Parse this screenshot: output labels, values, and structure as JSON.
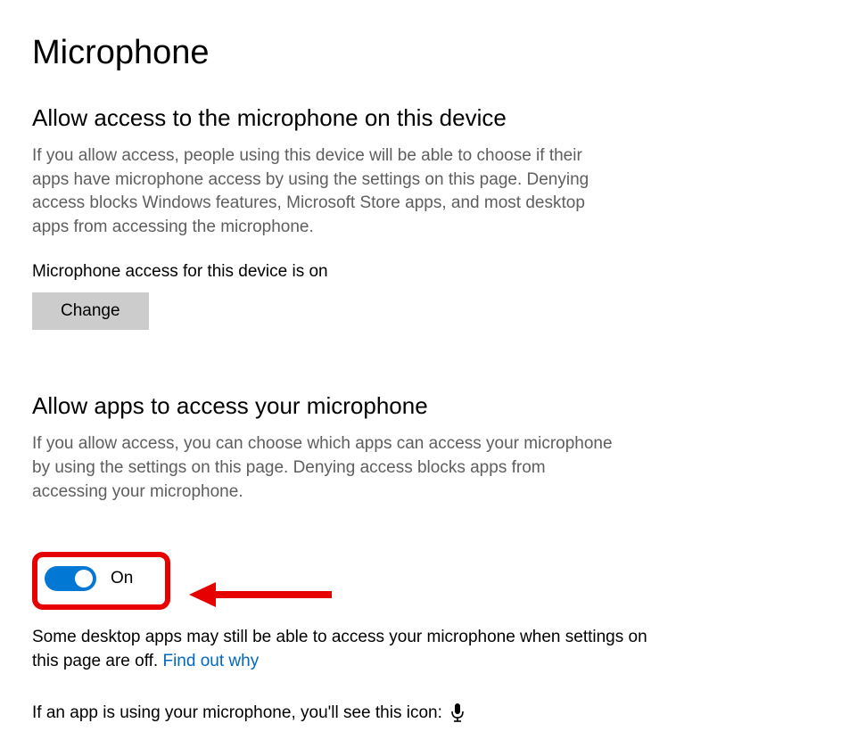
{
  "page_title": "Microphone",
  "section1": {
    "heading": "Allow access to the microphone on this device",
    "description": "If you allow access, people using this device will be able to choose if their apps have microphone access by using the settings on this page. Denying access blocks Windows features, Microsoft Store apps, and most desktop apps from accessing the microphone.",
    "status_line": "Microphone access for this device is on",
    "change_button": "Change"
  },
  "section2": {
    "heading": "Allow apps to access your microphone",
    "description": "If you allow access, you can choose which apps can access your microphone by using the settings on this page. Denying access blocks apps from accessing your microphone.",
    "toggle_label": "On",
    "footnote_prefix": "Some desktop apps may still be able to access your microphone when settings on this page are off. ",
    "footnote_link": "Find out why",
    "icon_line": "If an app is using your microphone, you'll see this icon:"
  },
  "colors": {
    "accent": "#0078d4",
    "highlight_border": "#e60000",
    "link": "#0067c0"
  }
}
